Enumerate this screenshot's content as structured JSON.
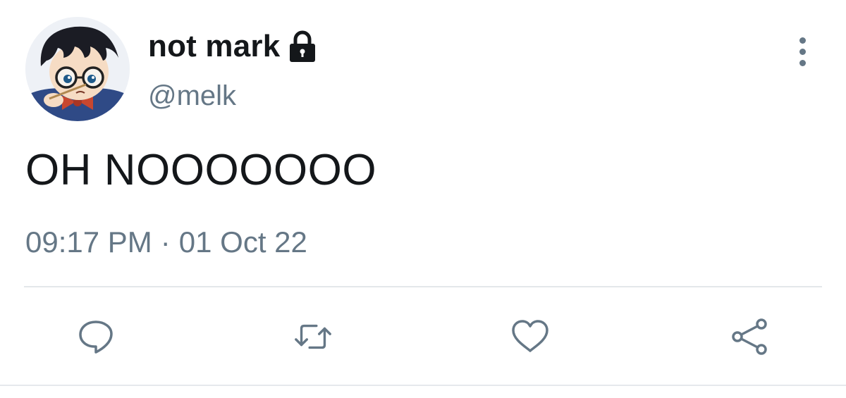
{
  "tweet": {
    "author": {
      "display_name": "not mark",
      "handle": "@melk",
      "protected_icon": "lock-icon",
      "avatar": "avatar"
    },
    "text": "OH NOOOOOOO",
    "meta": {
      "time": "09:17 PM",
      "separator": "·",
      "date": "01 Oct 22"
    },
    "actions": [
      {
        "name": "reply",
        "icon": "reply-icon"
      },
      {
        "name": "retweet",
        "icon": "retweet-icon"
      },
      {
        "name": "like",
        "icon": "heart-icon"
      },
      {
        "name": "share",
        "icon": "share-icon"
      }
    ],
    "more_icon": "more-vertical-icon"
  },
  "colors": {
    "primary_text": "#14171a",
    "secondary_text": "#657786",
    "divider": "#e3e7ea",
    "background": "#ffffff"
  }
}
